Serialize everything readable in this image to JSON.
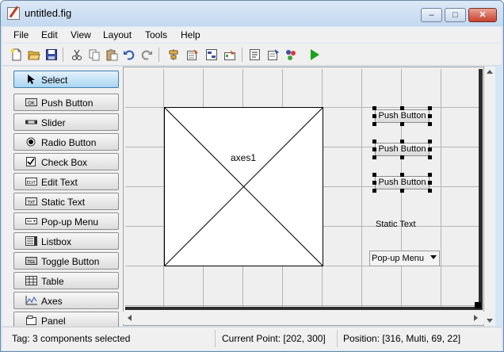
{
  "window": {
    "title": "untitled.fig",
    "controls": {
      "minimize": "–",
      "maximize": "□",
      "close": "✕"
    }
  },
  "menubar": {
    "items": [
      "File",
      "Edit",
      "View",
      "Layout",
      "Tools",
      "Help"
    ]
  },
  "toolbar": {
    "icons": [
      "new-file-icon",
      "open-folder-icon",
      "save-icon",
      "cut-icon",
      "copy-icon",
      "paste-icon",
      "undo-icon",
      "redo-icon",
      "align-objects-icon",
      "menu-editor-icon",
      "tab-order-editor-icon",
      "toolbar-editor-icon",
      "editor-icon",
      "property-inspector-icon",
      "object-browser-icon",
      "run-figure-icon"
    ],
    "colors": {
      "run": "#1aa31a",
      "folder": "#e8b43a",
      "save": "#3a4fa8"
    }
  },
  "palette": {
    "items": [
      {
        "label": "Select",
        "icon": "cursor-arrow-icon",
        "selected": true
      },
      {
        "label": "Push Button",
        "icon": "push-button-icon",
        "selected": false
      },
      {
        "label": "Slider",
        "icon": "slider-icon",
        "selected": false
      },
      {
        "label": "Radio Button",
        "icon": "radio-button-icon",
        "selected": false
      },
      {
        "label": "Check Box",
        "icon": "check-box-icon",
        "selected": false
      },
      {
        "label": "Edit Text",
        "icon": "edit-text-icon",
        "selected": false
      },
      {
        "label": "Static Text",
        "icon": "static-text-icon",
        "selected": false
      },
      {
        "label": "Pop-up Menu",
        "icon": "popup-menu-icon",
        "selected": false
      },
      {
        "label": "Listbox",
        "icon": "listbox-icon",
        "selected": false
      },
      {
        "label": "Toggle Button",
        "icon": "toggle-button-icon",
        "selected": false
      },
      {
        "label": "Table",
        "icon": "table-icon",
        "selected": false
      },
      {
        "label": "Axes",
        "icon": "axes-icon",
        "selected": false
      },
      {
        "label": "Panel",
        "icon": "panel-icon",
        "selected": false
      }
    ],
    "icon_text": {
      "push_button": "OK",
      "edit_text": "EDIT",
      "static_text": "TXT",
      "toggle_button": "TGL"
    }
  },
  "canvas": {
    "axes_label": "axes1",
    "push_buttons": [
      "Push Button",
      "Push Button",
      "Push Button"
    ],
    "static_text": "Static Text",
    "popup_menu": "Pop-up Menu"
  },
  "statusbar": {
    "tag": "Tag: 3 components selected",
    "current_point": "Current Point:  [202, 300]",
    "position": "Position: [316, Multi, 69, 22]"
  }
}
